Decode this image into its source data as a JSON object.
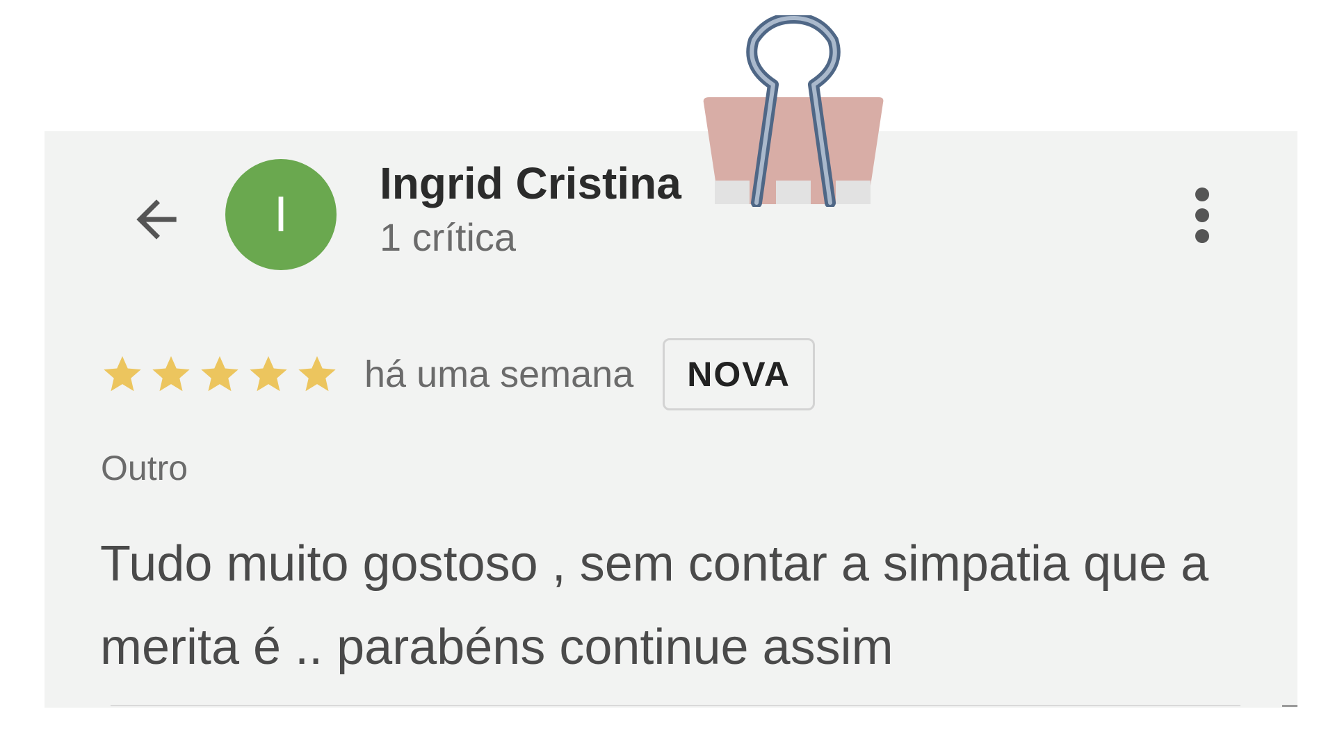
{
  "review": {
    "reviewer_name": "Ingrid Cristina",
    "reviewer_review_count": "1 crítica",
    "avatar_initial": "I",
    "rating": 5,
    "rating_max": 5,
    "date": "há uma semana",
    "badge": "NOVA",
    "category": "Outro",
    "text": "Tudo muito gostoso , sem contar a simpatia que a merita é .. parabéns continue assim"
  },
  "icons": {
    "back": "arrow-left-icon",
    "more": "more-vertical-icon",
    "star": "star-icon",
    "clip": "binder-clip-icon"
  },
  "colors": {
    "card_background": "#f2f3f2",
    "avatar": "#6aa84f",
    "star": "#ecc55e",
    "clip_body": "#d8ada6",
    "clip_wire": "#6f85a4"
  }
}
